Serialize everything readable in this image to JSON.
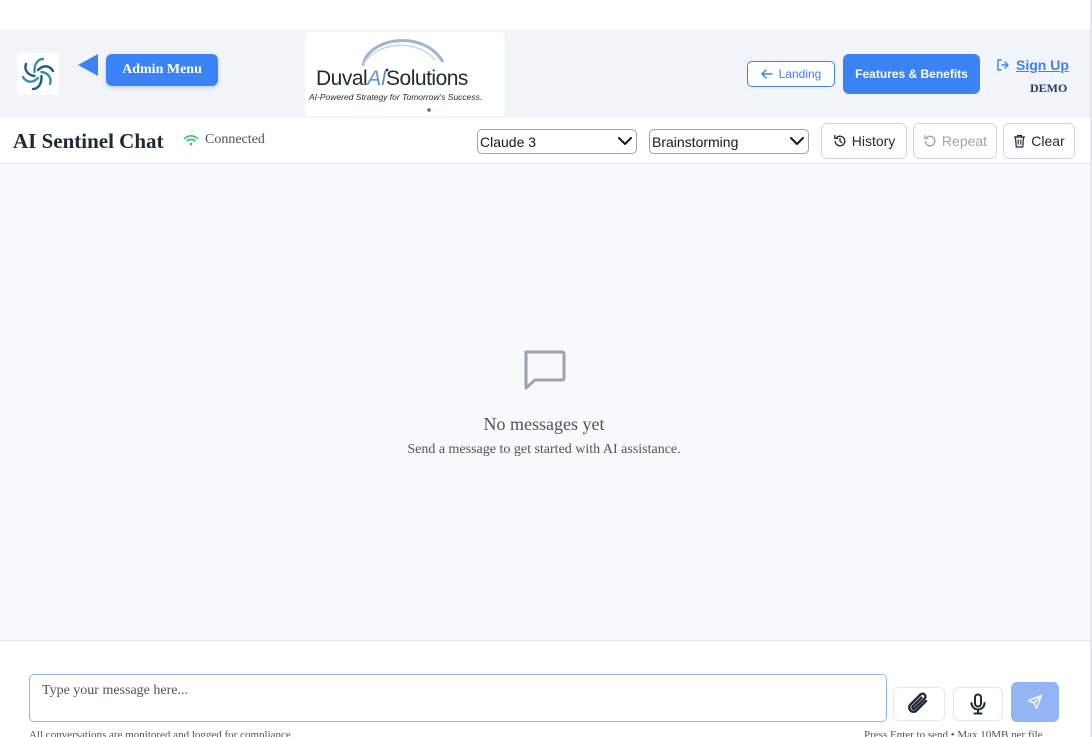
{
  "header": {
    "admin_menu_label": "Admin Menu",
    "brand": {
      "name_prefix": "Duval",
      "name_ai": "AI",
      "name_suffix": "Solutions",
      "tagline": "AI-Powered Strategy for Tomorrow's Success."
    },
    "landing_label": "Landing",
    "features_label": "Features & Benefits",
    "signup_label": "Sign Up",
    "demo_label": "DEMO",
    "accent_color": "#3b82f6"
  },
  "chat": {
    "title": "AI Sentinel Chat",
    "status": "Connected",
    "status_color": "#22c55e",
    "model_select": {
      "selected": "Claude 3"
    },
    "mode_select": {
      "selected": "Brainstorming"
    },
    "toolbar": {
      "history_label": "History",
      "repeat_label": "Repeat",
      "clear_label": "Clear"
    }
  },
  "empty_state": {
    "icon": "message-square-icon",
    "title": "No messages yet",
    "subtitle": "Send a message to get started with AI assistance."
  },
  "composer": {
    "placeholder": "Type your message here...",
    "footnote_left": "All conversations are monitored and logged for compliance.",
    "footnote_right": "Press Enter to send • Max 10MB per file"
  }
}
